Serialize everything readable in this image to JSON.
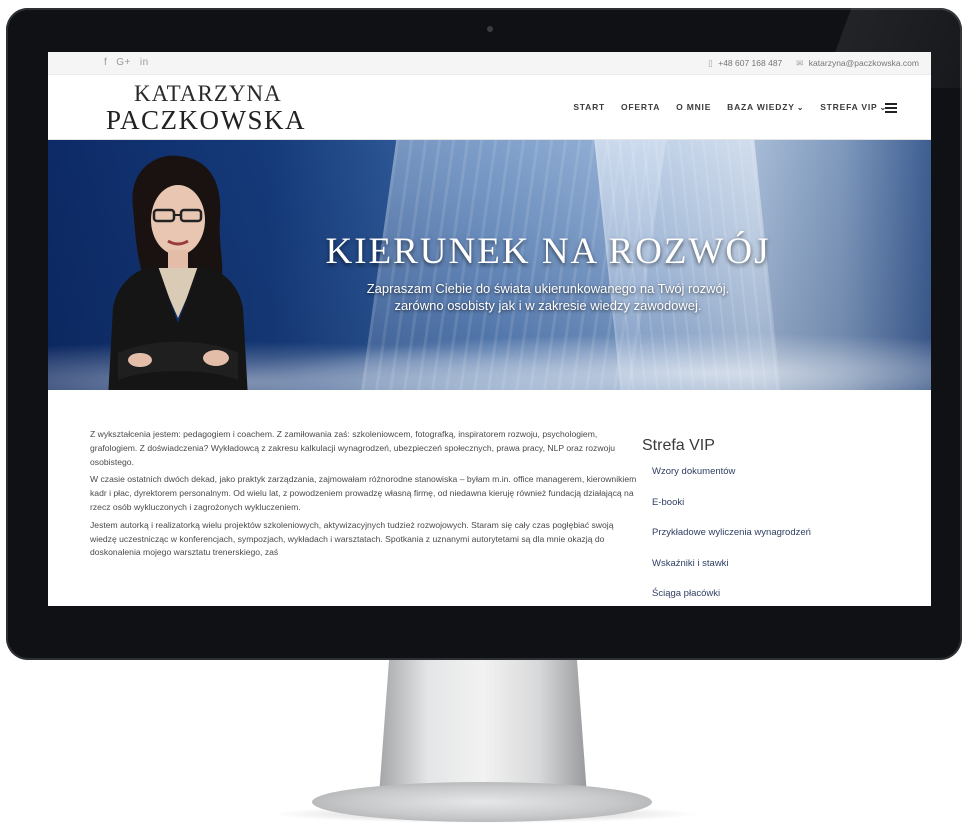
{
  "topbar": {
    "social": [
      "f",
      "G+",
      "in"
    ],
    "phone_icon": "phone-icon",
    "phone": "+48 607 168 487",
    "email_icon": "mail-icon",
    "email": "katarzyna@paczkowska.com"
  },
  "logo": {
    "line1": "KATARZYNA",
    "line2": "PACZKOWSKA"
  },
  "nav": {
    "items": [
      "START",
      "OFERTA",
      "O MNIE",
      "BAZA WIEDZY",
      "STREFA VIP"
    ],
    "menu_icon": "hamburger-icon"
  },
  "hero": {
    "title": "KIERUNEK NA ROZWÓJ",
    "subtitle_line1": "Zapraszam Ciebie do świata ukierunkowanego na Twój rozwój.",
    "subtitle_line2": "zarówno osobisty jak i w zakresie wiedzy zawodowej."
  },
  "content": {
    "paragraphs": [
      "Z wykształcenia jestem: pedagogiem i coachem. Z zamiłowania zaś: szkoleniowcem, fotografką, inspiratorem rozwoju, psychologiem, grafologiem. Z doświadczenia? Wykładowcą z zakresu kalkulacji wynagrodzeń, ubezpieczeń społecznych, prawa pracy, NLP oraz rozwoju osobistego.",
      "W  czasie ostatnich dwóch dekad, jako praktyk zarządzania, zajmowałam różnorodne stanowiska – byłam m.in. office managerem, kierownikiem kadr i płac, dyrektorem personalnym. Od wielu lat, z powodzeniem prowadzę własną firmę, od niedawna kieruję również fundacją działającą na rzecz osób wykluczonych i zagrożonych wykluczeniem.",
      "Jestem autorką i realizatorką wielu projektów szkoleniowych, aktywizacyjnych tudzież rozwojowych. Staram się cały czas pogłębiać swoją wiedzę uczestnicząc w konferencjach, sympozjach, wykładach i warsztatach. Spotkania z uznanymi autorytetami są dla mnie okazją do doskonalenia mojego warsztatu trenerskiego, zaś"
    ]
  },
  "sidebar": {
    "title": "Strefa VIP",
    "links": [
      "Wzory dokumentów",
      "E-booki",
      "Przykładowe wyliczenia wynagrodzeń",
      "Wskaźniki i stawki",
      "Ściąga płacówki"
    ]
  }
}
